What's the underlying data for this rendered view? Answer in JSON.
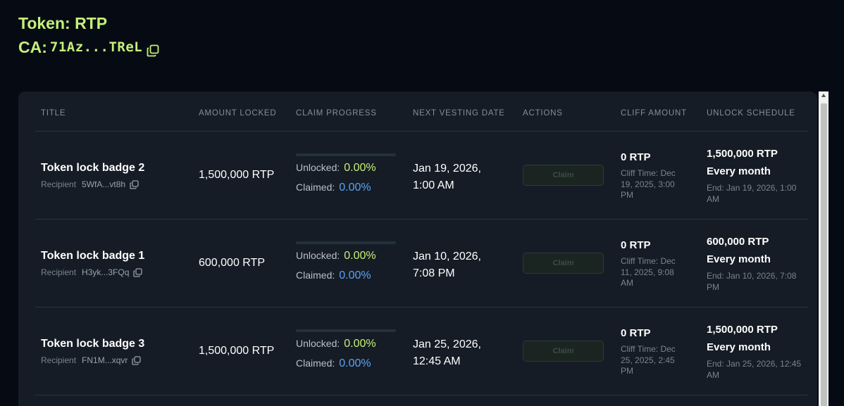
{
  "header": {
    "token_label": "Token: RTP",
    "ca_label": "CA:",
    "ca_address": "71Az...TReL"
  },
  "table": {
    "columns": [
      "TITLE",
      "AMOUNT LOCKED",
      "CLAIM PROGRESS",
      "NEXT VESTING DATE",
      "ACTIONS",
      "CLIFF AMOUNT",
      "UNLOCK SCHEDULE"
    ],
    "rows": [
      {
        "title": "Token lock badge 2",
        "recipient_label": "Recipient",
        "recipient": "5WfA...vt8h",
        "amount_locked": "1,500,000 RTP",
        "progress_fraction": 0,
        "unlocked_label": "Unlocked:",
        "unlocked": "0.00%",
        "claimed_label": "Claimed:",
        "claimed": "0.00%",
        "next_vesting": "Jan 19, 2026, 1:00 AM",
        "action": "Claim",
        "cliff_amount": "0 RTP",
        "cliff_time": "Cliff Time: Dec 19, 2025, 3:00 PM",
        "unlock_amount": "1,500,000 RTP",
        "unlock_frequency": "Every month",
        "unlock_end": "End: Jan 19, 2026, 1:00 AM"
      },
      {
        "title": "Token lock badge 1",
        "recipient_label": "Recipient",
        "recipient": "H3yk...3FQq",
        "amount_locked": "600,000 RTP",
        "progress_fraction": 0,
        "unlocked_label": "Unlocked:",
        "unlocked": "0.00%",
        "claimed_label": "Claimed:",
        "claimed": "0.00%",
        "next_vesting": "Jan 10, 2026, 7:08 PM",
        "action": "Claim",
        "cliff_amount": "0 RTP",
        "cliff_time": "Cliff Time: Dec 11, 2025, 9:08 AM",
        "unlock_amount": "600,000 RTP",
        "unlock_frequency": "Every month",
        "unlock_end": "End: Jan 10, 2026, 7:08 PM"
      },
      {
        "title": "Token lock badge 3",
        "recipient_label": "Recipient",
        "recipient": "FN1M...xqvr",
        "amount_locked": "1,500,000 RTP",
        "progress_fraction": 0,
        "unlocked_label": "Unlocked:",
        "unlocked": "0.00%",
        "claimed_label": "Claimed:",
        "claimed": "0.00%",
        "next_vesting": "Jan 25, 2026, 12:45 AM",
        "action": "Claim",
        "cliff_amount": "0 RTP",
        "cliff_time": "Cliff Time: Dec 25, 2025, 2:45 PM",
        "unlock_amount": "1,500,000 RTP",
        "unlock_frequency": "Every month",
        "unlock_end": "End: Jan 25, 2026, 12:45 AM"
      }
    ]
  },
  "colors": {
    "accent_green": "#c5f07a",
    "accent_blue": "#5aa2f5",
    "background": "#060b13",
    "panel": "#151c25"
  },
  "icons": [
    "copy-icon"
  ]
}
